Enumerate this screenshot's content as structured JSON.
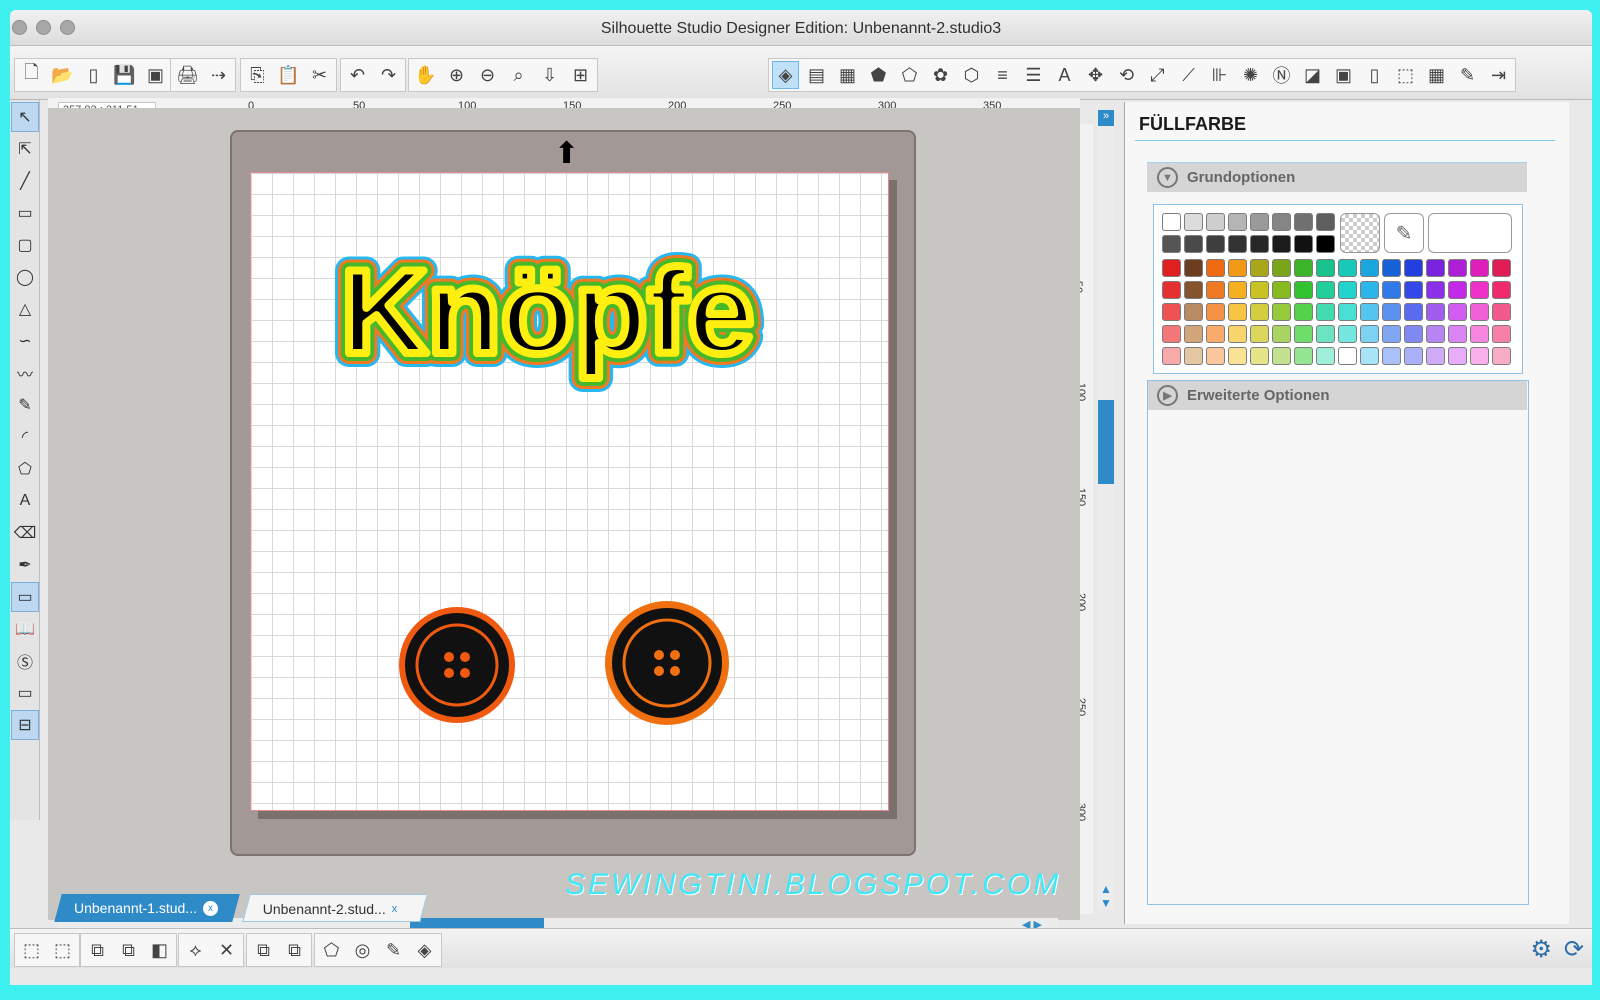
{
  "window": {
    "title": "Silhouette Studio Designer Edition: Unbenannt-2.studio3"
  },
  "coords": "357,82 ; 211,51",
  "ruler": {
    "top_ticks": [
      "0",
      "50",
      "100",
      "150",
      "200",
      "250",
      "300",
      "350"
    ],
    "left_ticks": [
      "0",
      "50",
      "100",
      "150",
      "200",
      "250",
      "300"
    ]
  },
  "design": {
    "text": "Knöpfe"
  },
  "panel": {
    "title": "FÜLLFARBE",
    "basic_options": "Grundoptionen",
    "advanced_options": "Erweiterte Optionen"
  },
  "tabs": [
    {
      "label": "Unbenannt-1.stud...",
      "active": false
    },
    {
      "label": "Unbenannt-2.stud...",
      "active": true
    }
  ],
  "watermark": "SEWINGTINI.BLOGSPOT.COM",
  "colors": {
    "greys": [
      "#ffffff",
      "#dcdcdc",
      "#cfcfcf",
      "#b5b5b5",
      "#9a9a9a",
      "#858585",
      "#707070",
      "#5f5f5f"
    ],
    "darkgreys": [
      "#555555",
      "#4a4a4a",
      "#3e3e3e",
      "#333333",
      "#272727",
      "#1c1c1c",
      "#111111",
      "#000000"
    ],
    "rows": [
      [
        "#e02020",
        "#6b3e1f",
        "#ef6a10",
        "#f29a16",
        "#a9a61a",
        "#7aa51b",
        "#3bb52a",
        "#17c28c",
        "#18c9b9",
        "#18a7df",
        "#1761d8",
        "#2240dd",
        "#7a23df",
        "#b01fd8",
        "#df1fb9",
        "#e01b55"
      ],
      [
        "#e63030",
        "#85532e",
        "#f07a24",
        "#f5b020",
        "#c8c222",
        "#88bb20",
        "#32c330",
        "#20cf9a",
        "#22d4cd",
        "#2bb6ea",
        "#2f79ea",
        "#3447e8",
        "#8c30ea",
        "#c329e8",
        "#ee2fc8",
        "#ef2b6d"
      ],
      [
        "#ef5252",
        "#b98b64",
        "#f59246",
        "#f7c444",
        "#d3cd3f",
        "#96ca3a",
        "#52d34a",
        "#43dcb0",
        "#48e0d6",
        "#55c5ef",
        "#5b92ef",
        "#5b6bef",
        "#a25df0",
        "#d05df0",
        "#f35fd6",
        "#f35a8c"
      ],
      [
        "#f47777",
        "#d2a57b",
        "#f9ab6b",
        "#f8d46c",
        "#dad65e",
        "#a9d462",
        "#6edd6a",
        "#6ce4c2",
        "#73e7e0",
        "#7dd2f3",
        "#7fa7f3",
        "#7f88f3",
        "#b684f3",
        "#da85f3",
        "#f686e0",
        "#f680a8"
      ],
      [
        "#f9aaaa",
        "#e3c6a2",
        "#fbc69b",
        "#fbe396",
        "#e6e488",
        "#c2e28f",
        "#94e693",
        "#a0efdb",
        "#ffffff",
        "#a9e3f8",
        "#a9c1f8",
        "#aab1f8",
        "#cfabf8",
        "#e8acf8",
        "#f9b0eb",
        "#f9acc6"
      ]
    ]
  }
}
